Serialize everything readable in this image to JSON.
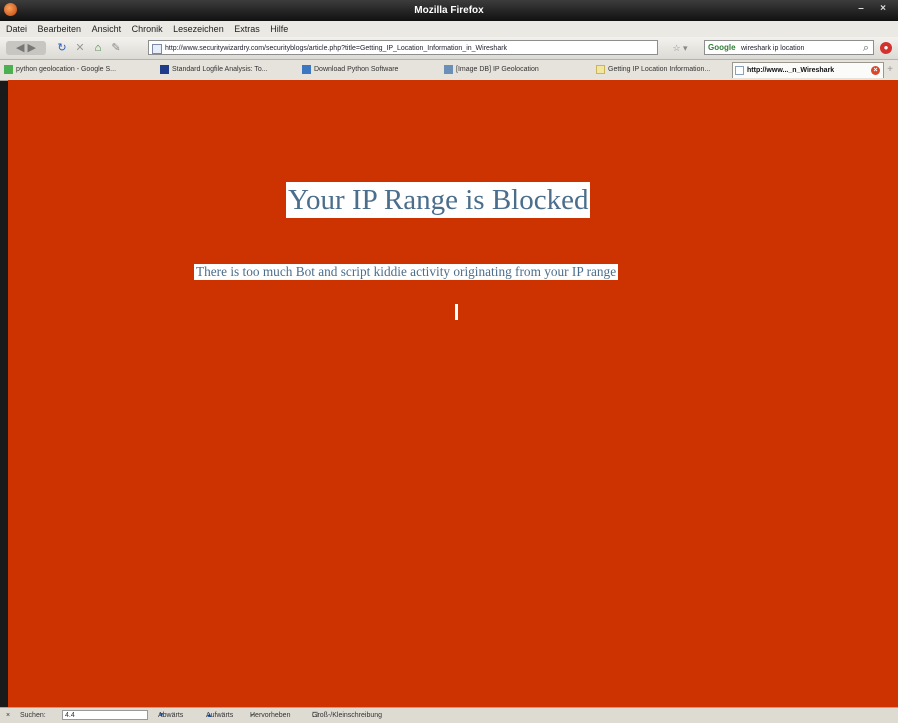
{
  "window": {
    "title": "Mozilla Firefox"
  },
  "menu": [
    "Datei",
    "Bearbeiten",
    "Ansicht",
    "Chronik",
    "Lesezeichen",
    "Extras",
    "Hilfe"
  ],
  "nav": {
    "url": "http://www.securitywizardry.com/securityblogs/article.php?title=Getting_IP_Location_Information_in_Wireshark",
    "search_engine": "Google",
    "search_value": "wireshark ip location"
  },
  "tabs": [
    "python geolocation - Google S...",
    "Standard Logfile Analysis: To...",
    "Download Python Software",
    "[Image DB] IP Geolocation",
    "Getting IP Location Information...",
    "http://www..._n_Wireshark"
  ],
  "page": {
    "heading": "Your IP Range is Blocked",
    "message": "There is too much Bot and script kiddie activity originating from your IP range"
  },
  "status": {
    "find_label": "Suchen:",
    "find_value": "4.4",
    "next": "Abwärts",
    "prev": "Aufwärts",
    "highlight": "Hervorheben",
    "case": "Groß-/Kleinschreibung"
  },
  "colors": {
    "content_bg": "#cc3300",
    "heading_text": "#4a6e8c"
  }
}
